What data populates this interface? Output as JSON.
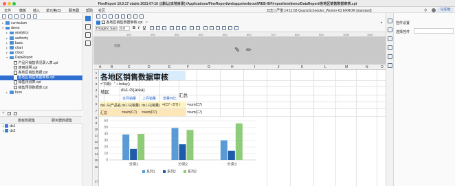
{
  "window": {
    "title": "FineReport 10.0.17 stable 2021-07-16 @默认[本地目录] /Applications/FineReport/webapps/webroot/WEB-INF/reportlets/demo/DataReport/各地区销售数据审核.cpt"
  },
  "menu": {
    "items": [
      "文件",
      "模板",
      "插入",
      "单元格(C)",
      "服务器",
      "帮助",
      "社区"
    ],
    "status": "日志 | 严重:14:11:58 QuartzScheduler_Worker-63 ERROR [standard]",
    "login_label": "马达哈"
  },
  "tree": {
    "rows": [
      {
        "label": "curriculum",
        "type": "folder",
        "expanded": false
      },
      {
        "label": "demo",
        "type": "folder",
        "expanded": true
      },
      {
        "label": "analytics",
        "type": "folder",
        "expanded": false
      },
      {
        "label": "authority",
        "type": "folder",
        "expanded": false
      },
      {
        "label": "basic",
        "type": "folder",
        "expanded": false
      },
      {
        "label": "chart",
        "type": "folder",
        "expanded": false
      },
      {
        "label": "cloud",
        "type": "folder",
        "expanded": false
      },
      {
        "label": "DataReport",
        "type": "folder",
        "expanded": true
      },
      {
        "label": "产品月销售情况录入表.cpt",
        "type": "file"
      },
      {
        "label": "使用说明.cpt",
        "type": "file"
      },
      {
        "label": "各地区销售数据.cpt",
        "type": "file"
      },
      {
        "label": "各地区销售数据审核.cpt",
        "type": "file",
        "selected": true
      },
      {
        "label": "销售预测表.cpt",
        "type": "file"
      },
      {
        "label": "销售预测数据表.cpt",
        "type": "file"
      },
      {
        "label": "form",
        "type": "folder",
        "expanded": false
      }
    ]
  },
  "dataset_panel": {
    "tabs": [
      "模板数据集",
      "服务器数据集"
    ],
    "items": [
      "ds1",
      "ds2"
    ]
  },
  "toolbar": {
    "document_tab": "各地区销售数据审核.cpt",
    "font_name": "Hiragino Sans GB",
    "font_size": "9.0",
    "format_buttons": [
      "B",
      "I",
      "U"
    ]
  },
  "ruler": {
    "marks": [
      "100",
      "200",
      "300",
      "400",
      "500",
      "600",
      "700",
      "800",
      "900",
      "1000",
      "1100"
    ]
  },
  "sheet": {
    "band_label": "页眉",
    "columns": [
      "A",
      "B",
      "C",
      "D",
      "E",
      "F",
      "G",
      "H",
      "I",
      "J",
      "K",
      "L",
      "M",
      "N",
      "O"
    ],
    "rows": [
      "1",
      "2",
      "3",
      "4",
      "5",
      "6",
      "7",
      "8",
      "9",
      "10",
      "11",
      "12",
      "13",
      "14",
      "15",
      "16",
      "17"
    ],
    "report_title": "各地区销售数据审核",
    "date_formula": "=\"日期：\" + today()",
    "region_label": "地区",
    "region_expr": "ds1.G(area)",
    "summary_header": "汇总",
    "month_labels": [
      "本月销量",
      "上月销量",
      "增量环比"
    ],
    "row7": [
      "ds1.G(产品名称)",
      "ds1.G(销量)",
      "ds1.G(销量)",
      "=(C7 - D7) / D7",
      "=sum(C7)"
    ],
    "row8": [
      "汇总",
      "=sum(C7)",
      "=sum(D7)",
      "=sum(C7)"
    ]
  },
  "chart_data": {
    "type": "bar",
    "categories": [
      "分类1",
      "分类2",
      "分类3"
    ],
    "series": [
      {
        "name": "系列1",
        "values": [
          39,
          49,
          30
        ],
        "color": "#5b9bd5"
      },
      {
        "name": "系列2",
        "values": [
          17,
          24,
          14
        ],
        "color": "#1f5ba8"
      },
      {
        "name": "系列3",
        "values": [
          40,
          46,
          56
        ],
        "color": "#8fcc7a"
      }
    ],
    "ylim": [
      0,
      60
    ],
    "yticks": [
      0,
      10,
      20,
      30,
      40,
      50,
      60
    ],
    "legend_position": "bottom",
    "grid": true
  },
  "right_panel": {
    "title": "控件设置",
    "field_label": "选择控件"
  }
}
